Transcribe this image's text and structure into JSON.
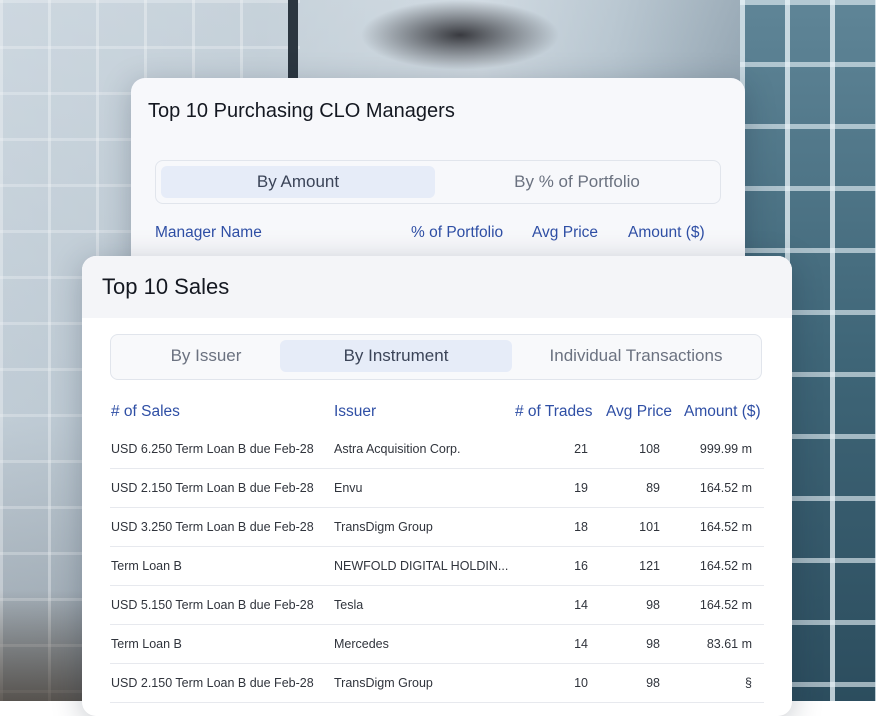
{
  "back_card": {
    "title": "Top 10 Purchasing CLO Managers",
    "tabs": [
      {
        "label": "By Amount",
        "active": true
      },
      {
        "label": "By % of Portfolio",
        "active": false
      }
    ],
    "columns": [
      "Manager Name",
      "% of Portfolio",
      "Avg Price",
      "Amount ($)"
    ]
  },
  "front_card": {
    "title": "Top 10 Sales",
    "tabs": [
      {
        "label": "By Issuer",
        "active": false
      },
      {
        "label": "By Instrument",
        "active": true
      },
      {
        "label": "Individual Transactions",
        "active": false
      }
    ],
    "columns": [
      "# of Sales",
      "Issuer",
      "# of Trades",
      "Avg Price",
      "Amount ($)"
    ],
    "rows": [
      {
        "sales": "USD 6.250 Term Loan B due Feb-28",
        "issuer": "Astra Acquisition Corp.",
        "trades": "21",
        "price": "108",
        "amount": "999.99 m"
      },
      {
        "sales": "USD 2.150 Term Loan B due Feb-28",
        "issuer": "Envu",
        "trades": "19",
        "price": "89",
        "amount": "164.52 m"
      },
      {
        "sales": "USD 3.250 Term Loan B due Feb-28",
        "issuer": "TransDigm Group",
        "trades": "18",
        "price": "101",
        "amount": "164.52 m"
      },
      {
        "sales": "Term Loan B",
        "issuer": "NEWFOLD DIGITAL HOLDIN...",
        "trades": "16",
        "price": "121",
        "amount": "164.52 m"
      },
      {
        "sales": "USD 5.150 Term Loan B due Feb-28",
        "issuer": "Tesla",
        "trades": "14",
        "price": "98",
        "amount": "164.52 m"
      },
      {
        "sales": "Term Loan B",
        "issuer": "Mercedes",
        "trades": "14",
        "price": "98",
        "amount": "83.61 m"
      },
      {
        "sales": "USD 2.150 Term Loan B due Feb-28",
        "issuer": "TransDigm Group",
        "trades": "10",
        "price": "98",
        "amount": "§"
      }
    ]
  }
}
